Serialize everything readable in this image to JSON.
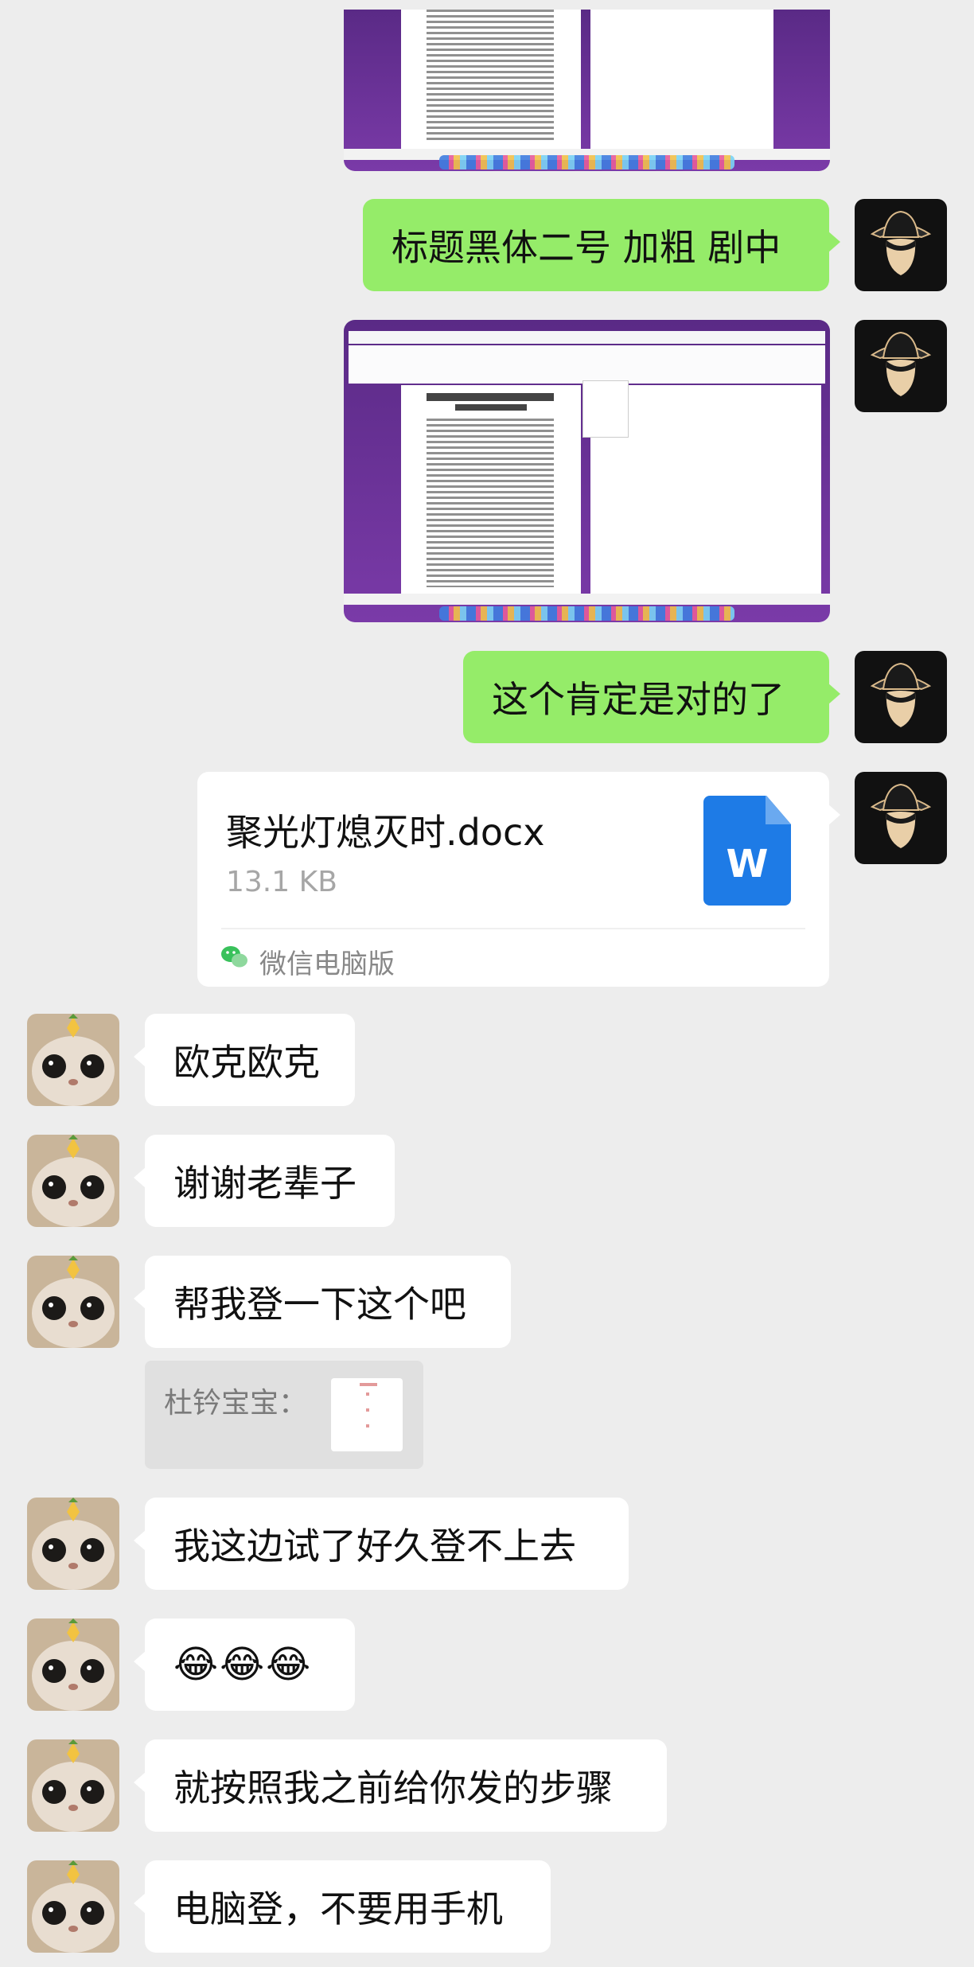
{
  "messages": {
    "m1_text": "标题黑体二号 加粗 剧中",
    "m2_text": "这个肯定是对的了",
    "file_name": "聚光灯熄灭时.docx",
    "file_size": "13.1 KB",
    "file_icon_letter": "W",
    "file_source": "微信电脑版",
    "m3_text": "欧克欧克",
    "m4_text": "谢谢老辈子",
    "m5_text": "帮我登一下这个吧",
    "quote_sender": "杜钤宝宝：",
    "m6_text": "我这边试了好久登不上去",
    "m7_emoji": "😂😂😂",
    "m8_text": "就按照我之前给你发的步骤",
    "m9_text": "电脑登，不要用手机"
  },
  "colors": {
    "background": "#ededed",
    "bubble_self": "#95ec69",
    "bubble_other": "#ffffff",
    "word_icon": "#1e7be6"
  },
  "icons": {
    "self_avatar": "hat-silhouette-avatar",
    "other_avatar": "cat-avatar",
    "file_type": "word-doc-icon",
    "source": "wechat-icon"
  }
}
